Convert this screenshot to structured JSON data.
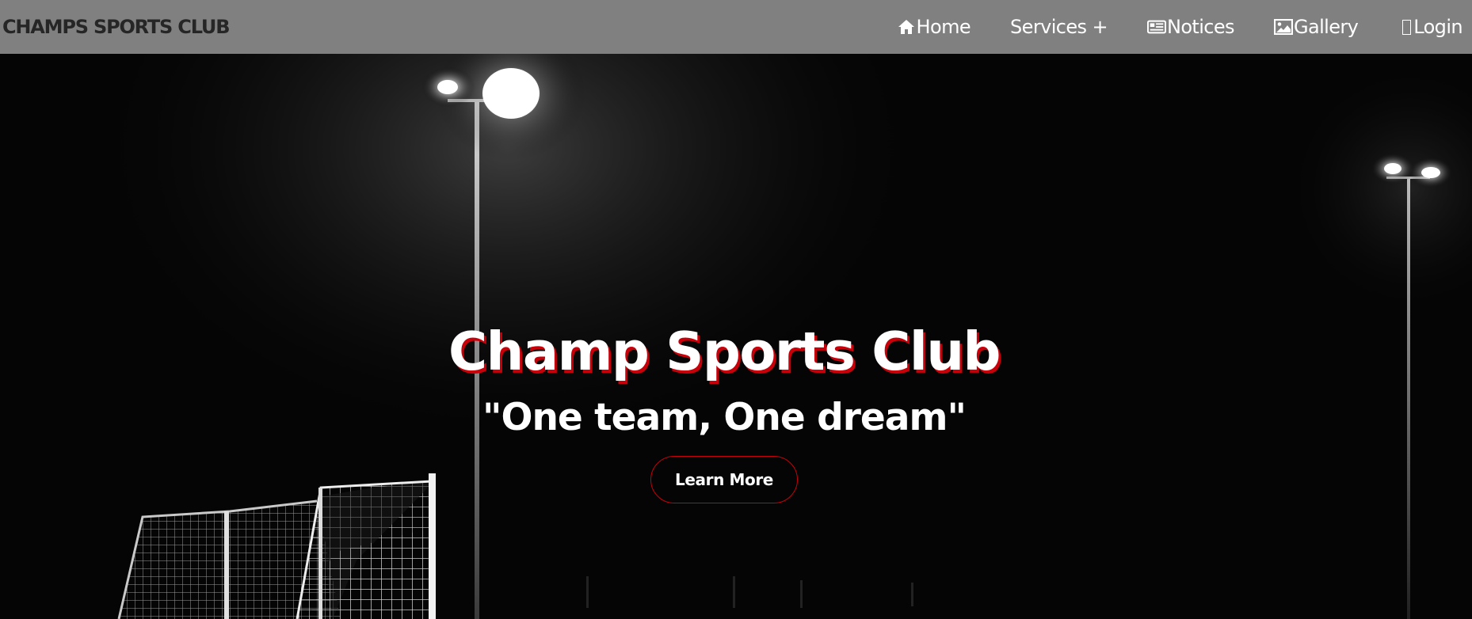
{
  "header": {
    "brand": "CHAMPS SPORTS CLUB",
    "nav": [
      {
        "label": "Home",
        "icon": "home-icon"
      },
      {
        "label": "Services +",
        "icon": ""
      },
      {
        "label": "Notices",
        "icon": "newspaper-icon"
      },
      {
        "label": "Gallery",
        "icon": "image-icon"
      },
      {
        "label": "Login",
        "icon": "missing-glyph-icon"
      }
    ]
  },
  "hero": {
    "title": "Champ Sports Club",
    "motto": "\"One team, One dream\"",
    "cta_label": "Learn More",
    "background": "night-floodlights-soccer-goal-photo"
  },
  "colors": {
    "navbar_bg": "#808080",
    "brand_text": "#262626",
    "accent_red": "#c8000a",
    "hero_bg": "#050505",
    "text_white": "#ffffff"
  }
}
